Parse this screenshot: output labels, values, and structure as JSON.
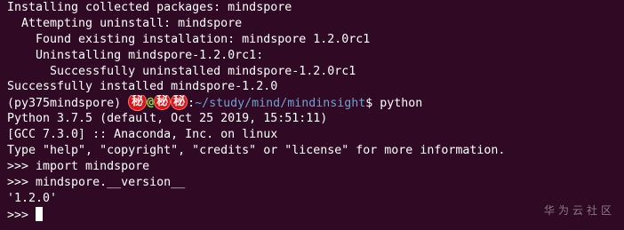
{
  "terminal": {
    "background_color": "#300a24",
    "text_color": "#ffffff",
    "path_color": "#729fcf",
    "lines": [
      "Installing collected packages: mindspore",
      "  Attempting uninstall: mindspore",
      "    Found existing installation: mindspore 1.2.0rc1",
      "    Uninstalling mindspore-1.2.0rc1:",
      "      Successfully uninstalled mindspore-1.2.0rc1",
      "Successfully installed mindspore-1.2.0"
    ],
    "prompt": {
      "env": "(py375mindspore) ",
      "redacted_user_icon": "red-seal-stamp",
      "at": "@",
      "redacted_host_icon": "red-seal-stamp",
      "separator": ":",
      "path": "~/study/mind/mindinsight",
      "dollar": "$ ",
      "command": "python"
    },
    "python_output": [
      "Python 3.7.5 (default, Oct 25 2019, 15:51:11)",
      "[GCC 7.3.0] :: Anaconda, Inc. on linux",
      "Type \"help\", \"copyright\", \"credits\" or \"license\" for more information.",
      ">>> import mindspore",
      ">>> mindspore.__version__",
      "'1.2.0'"
    ],
    "repl_prompt": ">>> ",
    "stamp_glyph": "秘"
  },
  "watermark": "华为云社区"
}
